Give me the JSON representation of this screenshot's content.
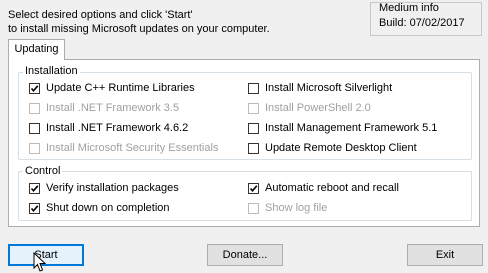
{
  "instructions": {
    "line1": "Select desired options and click 'Start'",
    "line2": "to install missing Microsoft updates on your computer."
  },
  "info": {
    "caption": "Medium info",
    "build": "Build: 07/02/2017"
  },
  "tab": {
    "label": "Updating"
  },
  "installation": {
    "legend": "Installation",
    "left": [
      {
        "label": "Update C++ Runtime Libraries",
        "checked": true,
        "enabled": true
      },
      {
        "label": "Install .NET Framework 3.5",
        "checked": false,
        "enabled": false
      },
      {
        "label": "Install .NET Framework 4.6.2",
        "checked": false,
        "enabled": true
      },
      {
        "label": "Install Microsoft Security Essentials",
        "checked": false,
        "enabled": false
      }
    ],
    "right": [
      {
        "label": "Install Microsoft Silverlight",
        "checked": false,
        "enabled": true
      },
      {
        "label": "Install PowerShell 2.0",
        "checked": false,
        "enabled": false
      },
      {
        "label": "Install Management Framework 5.1",
        "checked": false,
        "enabled": true
      },
      {
        "label": "Update Remote Desktop Client",
        "checked": false,
        "enabled": true
      }
    ]
  },
  "control": {
    "legend": "Control",
    "left": [
      {
        "label": "Verify installation packages",
        "checked": true,
        "enabled": true
      },
      {
        "label": "Shut down on completion",
        "checked": true,
        "enabled": true
      }
    ],
    "right": [
      {
        "label": "Automatic reboot and recall",
        "checked": true,
        "enabled": true
      },
      {
        "label": "Show log file",
        "checked": false,
        "enabled": false
      }
    ]
  },
  "buttons": {
    "start": "Start",
    "donate": "Donate...",
    "exit": "Exit"
  }
}
